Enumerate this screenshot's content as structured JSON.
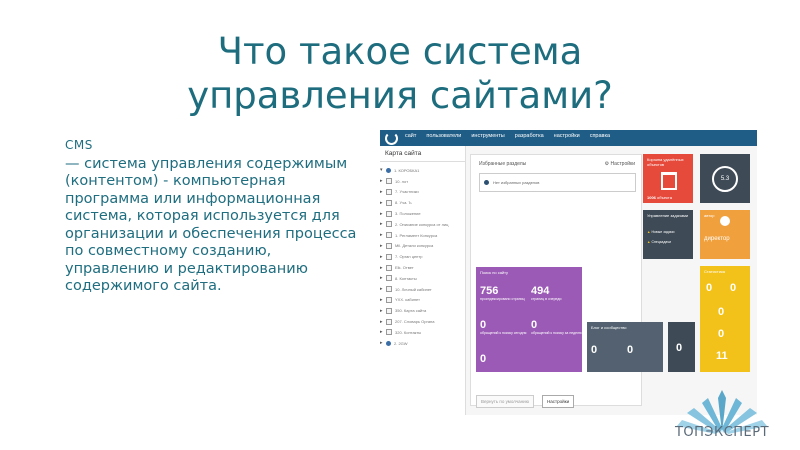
{
  "slide": {
    "title_line1": "Что такое система",
    "title_line2": "управления сайтами?",
    "cms_label": "CMS",
    "definition": "— система управления содержимым (контентом) - компьютерная программа или информационная система, которая используется для организации и обеспечения процесса по совместному созданию, управлению и редактированию содержимого сайта."
  },
  "screenshot": {
    "menu": [
      "сайт",
      "пользователи",
      "инструменты",
      "разработка",
      "настройки",
      "справка"
    ],
    "sidebar_title": "Карта сайта",
    "tree": [
      {
        "label": "1. КОРОБКА1",
        "mk": "▾",
        "globe": true
      },
      {
        "label": "10. лот",
        "mk": "▸"
      },
      {
        "label": "7. Участники",
        "mk": "▸"
      },
      {
        "label": "8. Уча. Ъ",
        "mk": "▸"
      },
      {
        "label": "3. Положение",
        "mk": "▸"
      },
      {
        "label": "2. Описание конкурса от лиц",
        "mk": "▸"
      },
      {
        "label": "1. Регламент Конкурса",
        "mk": "▸"
      },
      {
        "label": "Mil. Детали конкурса",
        "mk": "▸"
      },
      {
        "label": "7. Орган центр",
        "mk": "▸"
      },
      {
        "label": "Elk. Ответ",
        "mk": "▸"
      },
      {
        "label": "8. Контакты",
        "mk": "▸"
      },
      {
        "label": "10. Личный кабинет",
        "mk": "▸"
      },
      {
        "label": "YXX. кабинет",
        "mk": "▸"
      },
      {
        "label": "350. Карта сайта",
        "mk": "▸"
      },
      {
        "label": "207. Словарь Органа",
        "mk": "▸"
      },
      {
        "label": "320. Контакты",
        "mk": "▸"
      },
      {
        "label": "2. 2GW",
        "mk": "▸",
        "globe": true
      }
    ],
    "favorites_title": "Избранные разделы",
    "favorites_settings": "⚙ Настройки",
    "favorites_empty": "Нет избранных разделов",
    "tiles": {
      "red": {
        "hd": "Корзина удалённых объектов",
        "val": "1006",
        "unit": "объекта"
      },
      "dark": {
        "val": "5.3"
      },
      "warn": {
        "hd": "Управление задачами",
        "l1": "Новые задачи",
        "l2": "Спецзадачи"
      },
      "orange": {
        "hd": "автор",
        "name": "директор"
      },
      "purple": {
        "hd": "Поиск по сайту",
        "v1": "756",
        "v2": "494",
        "v3": "0",
        "v4": "0",
        "v5": "0",
        "l1": "проиндексировано страниц",
        "l2": "страниц в очереди",
        "l3": "обращений к поиску сегодня",
        "l4": "обращений к поиску за неделю"
      },
      "blog": {
        "hd": "Блог и сообщество",
        "v1": "0",
        "v2": "0"
      },
      "last": {
        "v": "0"
      },
      "yellow": {
        "hd": "Статистика",
        "v1": "0",
        "v2": "0",
        "v3": "0",
        "v4": "0",
        "v5": "11"
      }
    },
    "buttons": {
      "restore": "Вернуть по умолчанию",
      "settings": "Настройки"
    }
  },
  "brand": {
    "name": "ТОПЭКСПЕРТ"
  }
}
